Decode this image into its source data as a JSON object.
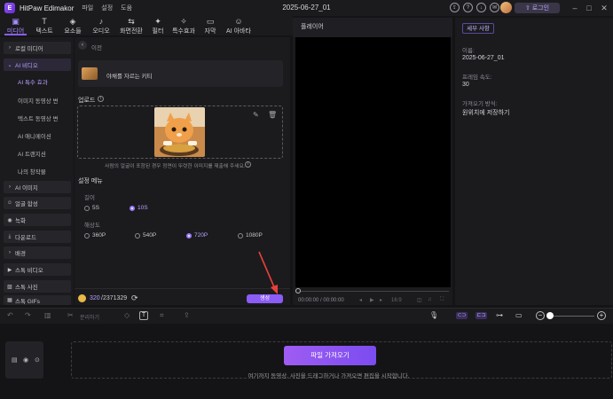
{
  "app": {
    "name": "HitPaw Edimakor",
    "doc_title": "2025-06-27_01",
    "login": "로그인",
    "menu": [
      "파일",
      "설정",
      "도움"
    ]
  },
  "tabs": [
    {
      "label": "미디어",
      "icon": "folder-icon",
      "glyph": "▣"
    },
    {
      "label": "텍스트",
      "icon": "text-icon",
      "glyph": "T"
    },
    {
      "label": "요소들",
      "icon": "elements-icon",
      "glyph": "◈"
    },
    {
      "label": "오디오",
      "icon": "music-icon",
      "glyph": "♪"
    },
    {
      "label": "화면전환",
      "icon": "transition-icon",
      "glyph": "⇆"
    },
    {
      "label": "필터",
      "icon": "filter-icon",
      "glyph": "✦"
    },
    {
      "label": "특수효과",
      "icon": "effects-icon",
      "glyph": "✧"
    },
    {
      "label": "자막",
      "icon": "subtitle-icon",
      "glyph": "▭"
    },
    {
      "label": "AI 아바타",
      "icon": "avatar-icon",
      "glyph": "☺"
    }
  ],
  "leftnav": {
    "local_media": "로컬 미디어",
    "ai_video": "AI 비디오",
    "sub": [
      "AI 특수 효과",
      "이미지 동영상 변",
      "텍스트 동영상 변",
      "AI 애니메이션",
      "AI 트랜지션",
      "나의 창작물"
    ],
    "ai_image": "AI 이미지",
    "face_swap": "얼굴 합성",
    "recording": "녹화",
    "download": "다운로드",
    "background": "배경",
    "stock_video": "스톡 비디오",
    "stock_photo": "스톡 사진",
    "stock_gif": "스톡 GIFs"
  },
  "content": {
    "back": "이전",
    "effect_name": "야채를 자르는 키티",
    "upload_label": "업로드",
    "upload_note": "사람의 얼굴이 포함된 경우 정면이 뚜렷한 이미지를 제출해 주세요.",
    "settings_label": "설정 메뉴",
    "length_label": "길이",
    "length_opts": [
      "5S",
      "10S"
    ],
    "length_selected": 1,
    "res_label": "해상도",
    "res_opts": [
      "360P",
      "540P",
      "720P",
      "1080P"
    ],
    "res_selected": 2,
    "credits": "320",
    "credits_total": "/2371329",
    "generate": "생성"
  },
  "player": {
    "tab": "플레이어",
    "time": "00:00:00 / 00:00:00",
    "ratio": "16:9"
  },
  "details": {
    "tab": "세부 사항",
    "name_label": "이름:",
    "name_value": "2025-06-27_01",
    "fps_label": "프레임 속도:",
    "fps_value": "30",
    "import_label": "가져오기 방식:",
    "import_value": "원위치에 저장하기"
  },
  "timeline": {
    "split": "분리하기",
    "import_btn": "파일 가져오기",
    "hint": "여기까지 동영상, 사진을 드래그하거나 가져오면 편집을 시작합니다."
  },
  "colors": {
    "accent": "#8b5cf6",
    "bg": "#141416",
    "panel": "#1b1b1e"
  }
}
